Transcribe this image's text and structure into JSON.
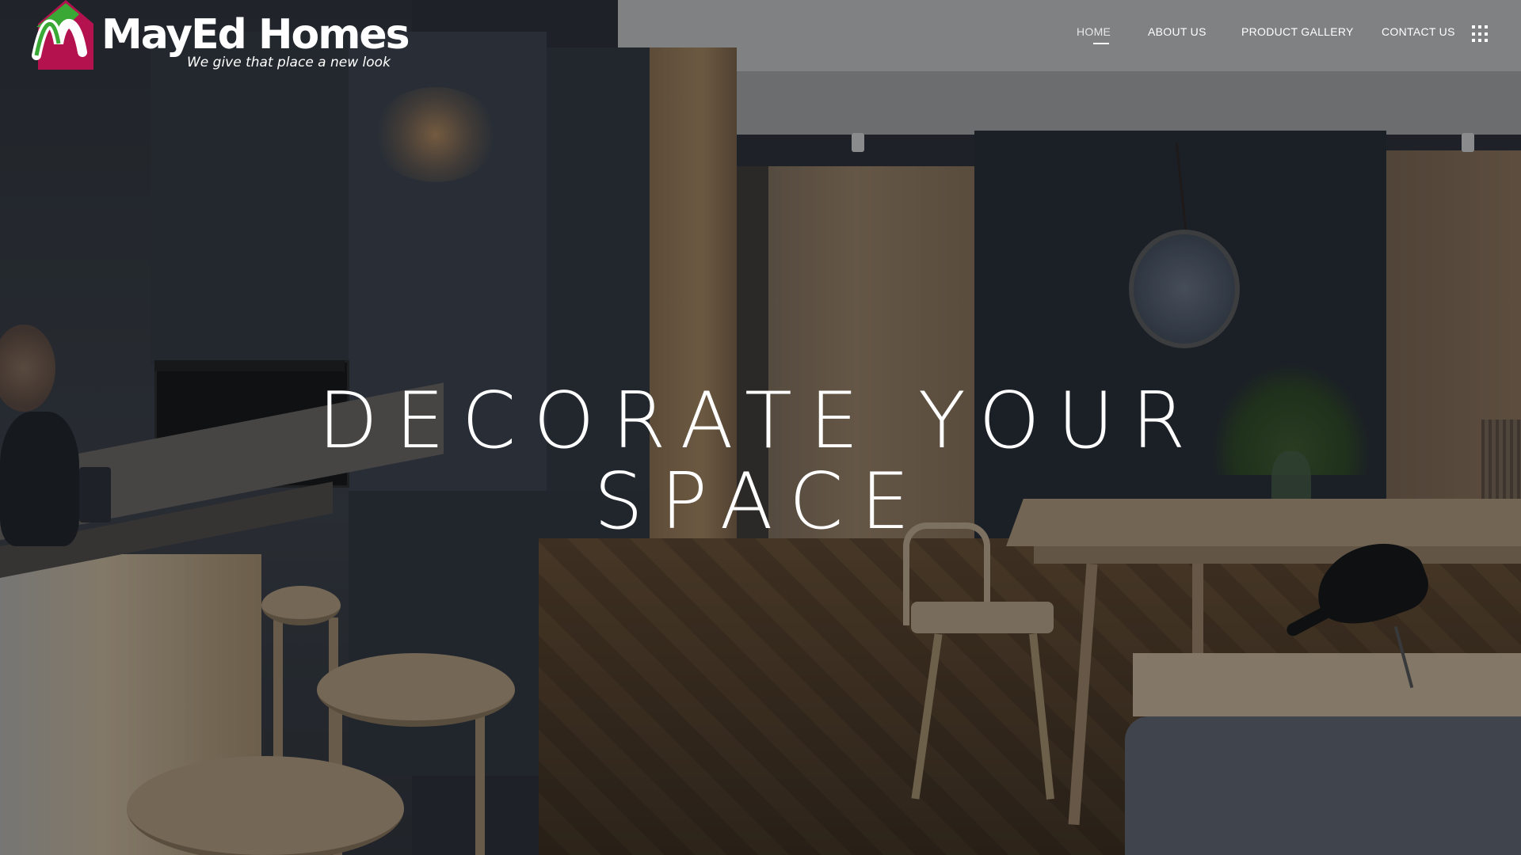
{
  "brand": {
    "name": "MayEd Homes",
    "tagline": "We give that place a new look",
    "logo_mark_letter": "M",
    "colors": {
      "green": "#3aa835",
      "magenta": "#b3124f",
      "white": "#ffffff"
    }
  },
  "nav": {
    "items": [
      {
        "label": "HOME",
        "active": true
      },
      {
        "label": "ABOUT US",
        "active": false
      },
      {
        "label": "PRODUCT GALLERY",
        "active": false
      },
      {
        "label": "CONTACT US",
        "active": false
      }
    ],
    "menu_icon": "grid-menu-icon"
  },
  "hero": {
    "title_line_1": "DECORATE YOUR",
    "title_line_2": "SPACE",
    "background": "interior-kitchen-dining-photo"
  }
}
